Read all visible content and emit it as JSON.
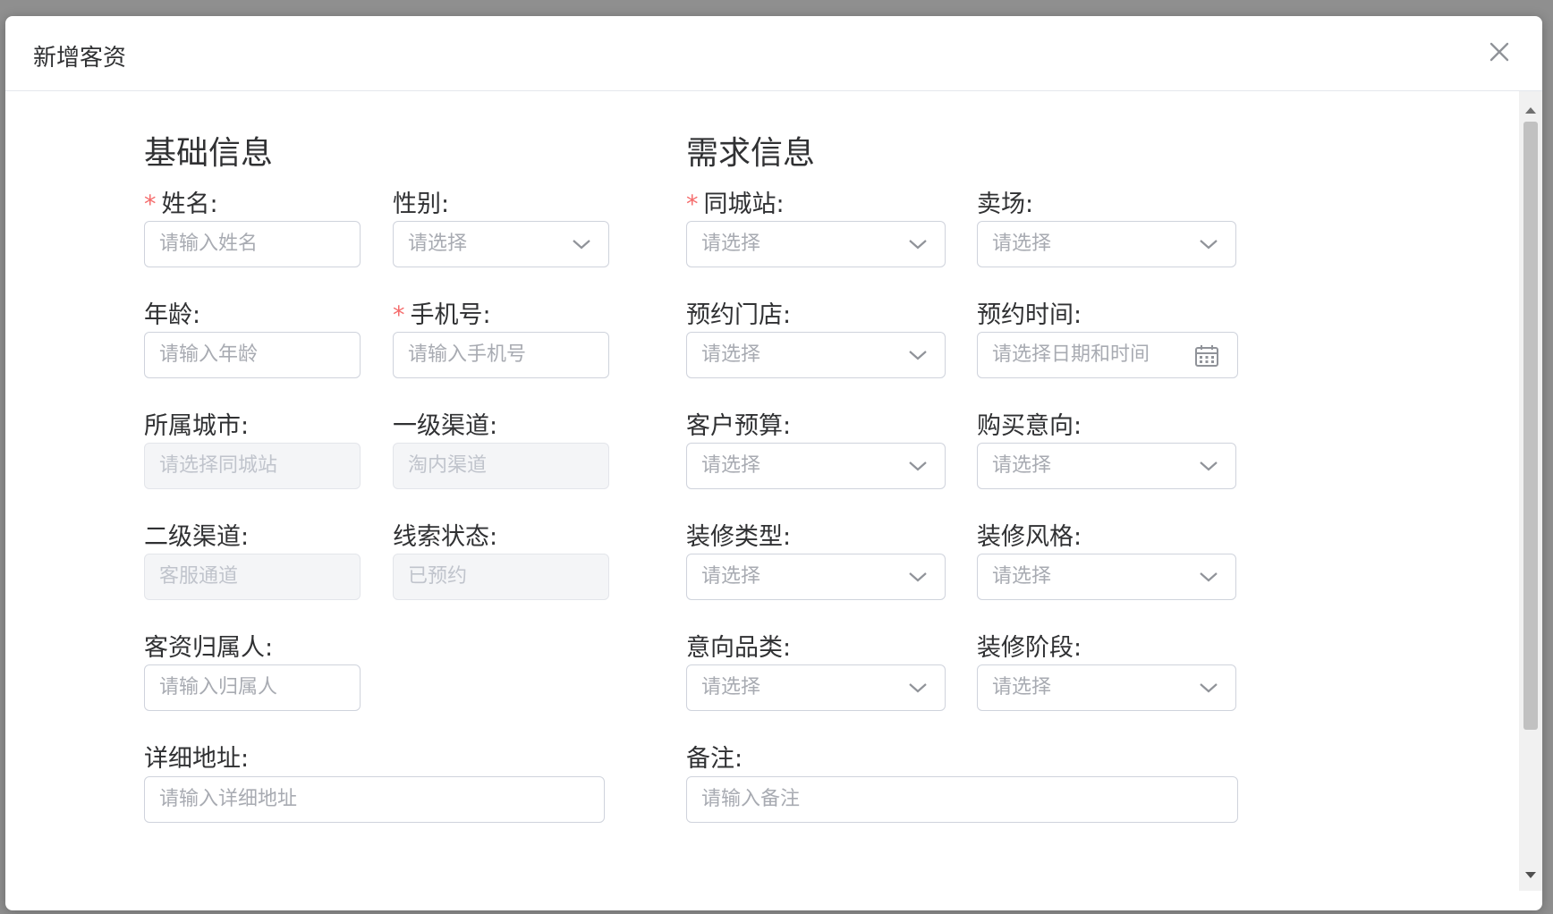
{
  "dialog": {
    "title": "新增客资"
  },
  "sections": {
    "basic": "基础信息",
    "demand": "需求信息"
  },
  "fields": {
    "name": {
      "label": "姓名:",
      "placeholder": "请输入姓名",
      "required": true
    },
    "gender": {
      "label": "性别:",
      "placeholder": "请选择"
    },
    "age": {
      "label": "年龄:",
      "placeholder": "请输入年龄"
    },
    "phone": {
      "label": "手机号:",
      "placeholder": "请输入手机号",
      "required": true
    },
    "city": {
      "label": "所属城市:",
      "placeholder": "请选择同城站"
    },
    "channel1": {
      "label": "一级渠道:",
      "value": "淘内渠道"
    },
    "channel2": {
      "label": "二级渠道:",
      "value": "客服通道"
    },
    "leadStatus": {
      "label": "线索状态:",
      "value": "已预约"
    },
    "owner": {
      "label": "客资归属人:",
      "placeholder": "请输入归属人"
    },
    "address": {
      "label": "详细地址:",
      "placeholder": "请输入详细地址"
    },
    "station": {
      "label": "同城站:",
      "placeholder": "请选择",
      "required": true
    },
    "mall": {
      "label": "卖场:",
      "placeholder": "请选择"
    },
    "store": {
      "label": "预约门店:",
      "placeholder": "请选择"
    },
    "apptTime": {
      "label": "预约时间:",
      "placeholder": "请选择日期和时间"
    },
    "budget": {
      "label": "客户预算:",
      "placeholder": "请选择"
    },
    "intent": {
      "label": "购买意向:",
      "placeholder": "请选择"
    },
    "decoType": {
      "label": "装修类型:",
      "placeholder": "请选择"
    },
    "decoStyle": {
      "label": "装修风格:",
      "placeholder": "请选择"
    },
    "category": {
      "label": "意向品类:",
      "placeholder": "请选择"
    },
    "decoStage": {
      "label": "装修阶段:",
      "placeholder": "请选择"
    },
    "remark": {
      "label": "备注:",
      "placeholder": "请输入备注"
    }
  },
  "required_mark": "*",
  "colors": {
    "required": "#f56c6c",
    "border": "#cfd3dc",
    "placeholder": "#a8abb2",
    "disabled_bg": "#f4f5f7",
    "overlay": "#8f8f8f"
  },
  "icons": {
    "close": "close-icon",
    "select": "chevron-down-icon",
    "date": "calendar-icon"
  }
}
